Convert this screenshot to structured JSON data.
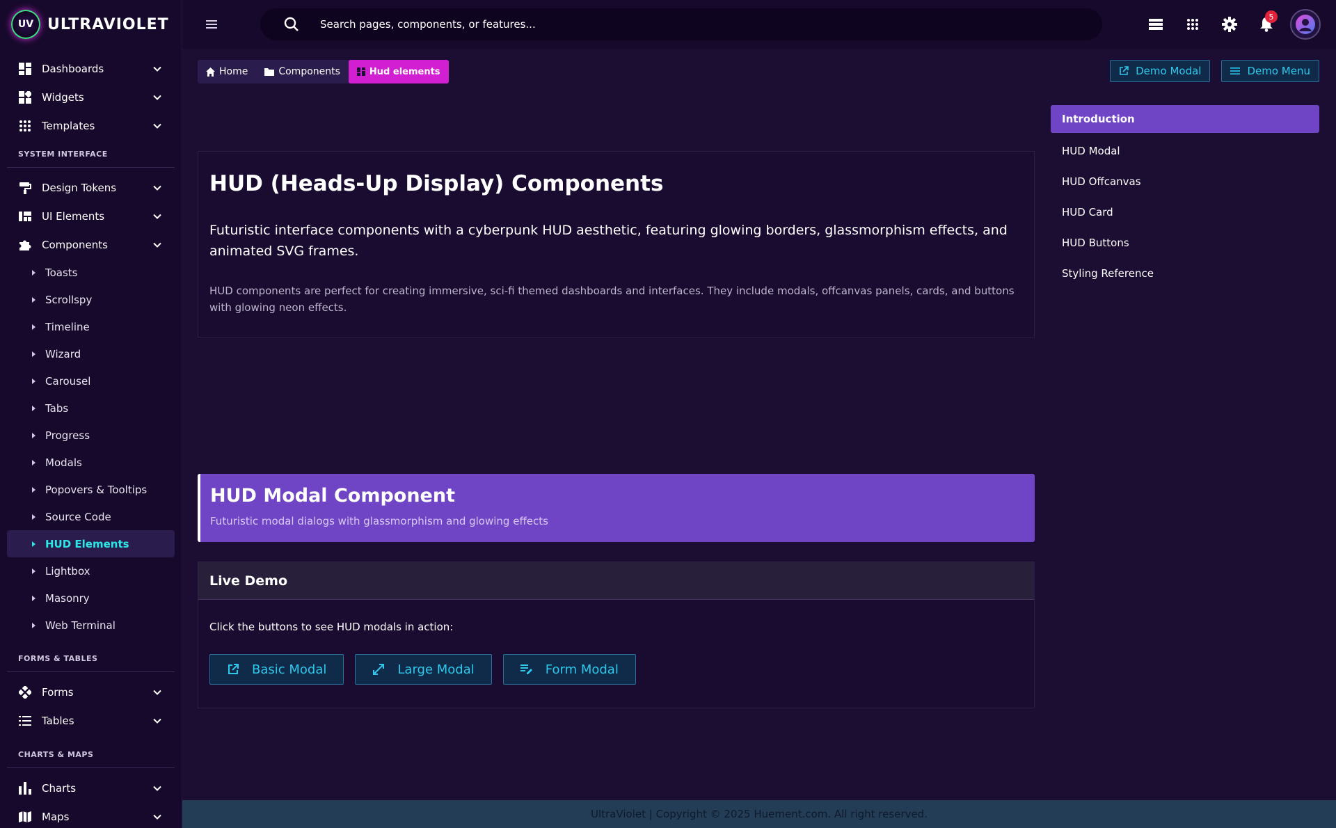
{
  "brand": {
    "name": "ULTRAVIOLET",
    "logo_text": "UV"
  },
  "sidebar": {
    "top_items": [
      {
        "label": "Dashboards",
        "icon": "dashboard-icon"
      },
      {
        "label": "Widgets",
        "icon": "widgets-icon"
      },
      {
        "label": "Templates",
        "icon": "apps-grid-icon"
      }
    ],
    "section_system": "SYSTEM INTERFACE",
    "system_items": [
      {
        "label": "Design Tokens",
        "icon": "paint-roller-icon"
      },
      {
        "label": "UI Elements",
        "icon": "ui-elements-icon"
      },
      {
        "label": "Components",
        "icon": "puzzle-icon"
      }
    ],
    "component_subitems": [
      "Toasts",
      "Scrollspy",
      "Timeline",
      "Wizard",
      "Carousel",
      "Tabs",
      "Progress",
      "Modals",
      "Popovers & Tooltips",
      "Source Code",
      "HUD Elements",
      "Lightbox",
      "Masonry",
      "Web Terminal"
    ],
    "active_subitem": "HUD Elements",
    "section_forms": "FORMS & TABLES",
    "forms_items": [
      {
        "label": "Forms",
        "icon": "forms-icon"
      },
      {
        "label": "Tables",
        "icon": "tables-icon"
      }
    ],
    "section_charts": "CHARTS & MAPS",
    "charts_items": [
      {
        "label": "Charts",
        "icon": "bar-chart-icon"
      },
      {
        "label": "Maps",
        "icon": "map-icon"
      }
    ]
  },
  "topbar": {
    "search_placeholder": "Search pages, components, or features...",
    "notification_count": "5"
  },
  "breadcrumb": {
    "home": "Home",
    "components": "Components",
    "current": "Hud elements"
  },
  "header_buttons": {
    "demo_modal": "Demo Modal",
    "demo_menu": "Demo Menu"
  },
  "intro": {
    "title": "HUD (Heads-Up Display) Components",
    "lead": "Futuristic interface components with a cyberpunk HUD aesthetic, featuring glowing borders, glassmorphism effects, and animated SVG frames.",
    "body": "HUD components are perfect for creating immersive, sci-fi themed dashboards and interfaces. They include modals, offcanvas panels, cards, and buttons with glowing neon effects."
  },
  "modal_section": {
    "title": "HUD Modal Component",
    "subtitle": "Futuristic modal dialogs with glassmorphism and glowing effects"
  },
  "live_demo": {
    "title": "Live Demo",
    "text": "Click the buttons to see HUD modals in action:",
    "buttons": [
      "Basic Modal",
      "Large Modal",
      "Form Modal"
    ]
  },
  "toc": [
    "Introduction",
    "HUD Modal",
    "HUD Offcanvas",
    "HUD Card",
    "HUD Buttons",
    "Styling Reference"
  ],
  "footer": "UltraViolet | Copyright © 2025 Huement.com. All right reserved.",
  "colors": {
    "accent_purple": "#6f45c6",
    "accent_cyan": "#2ec8ea",
    "crumb_magenta": "#d21fd2"
  }
}
